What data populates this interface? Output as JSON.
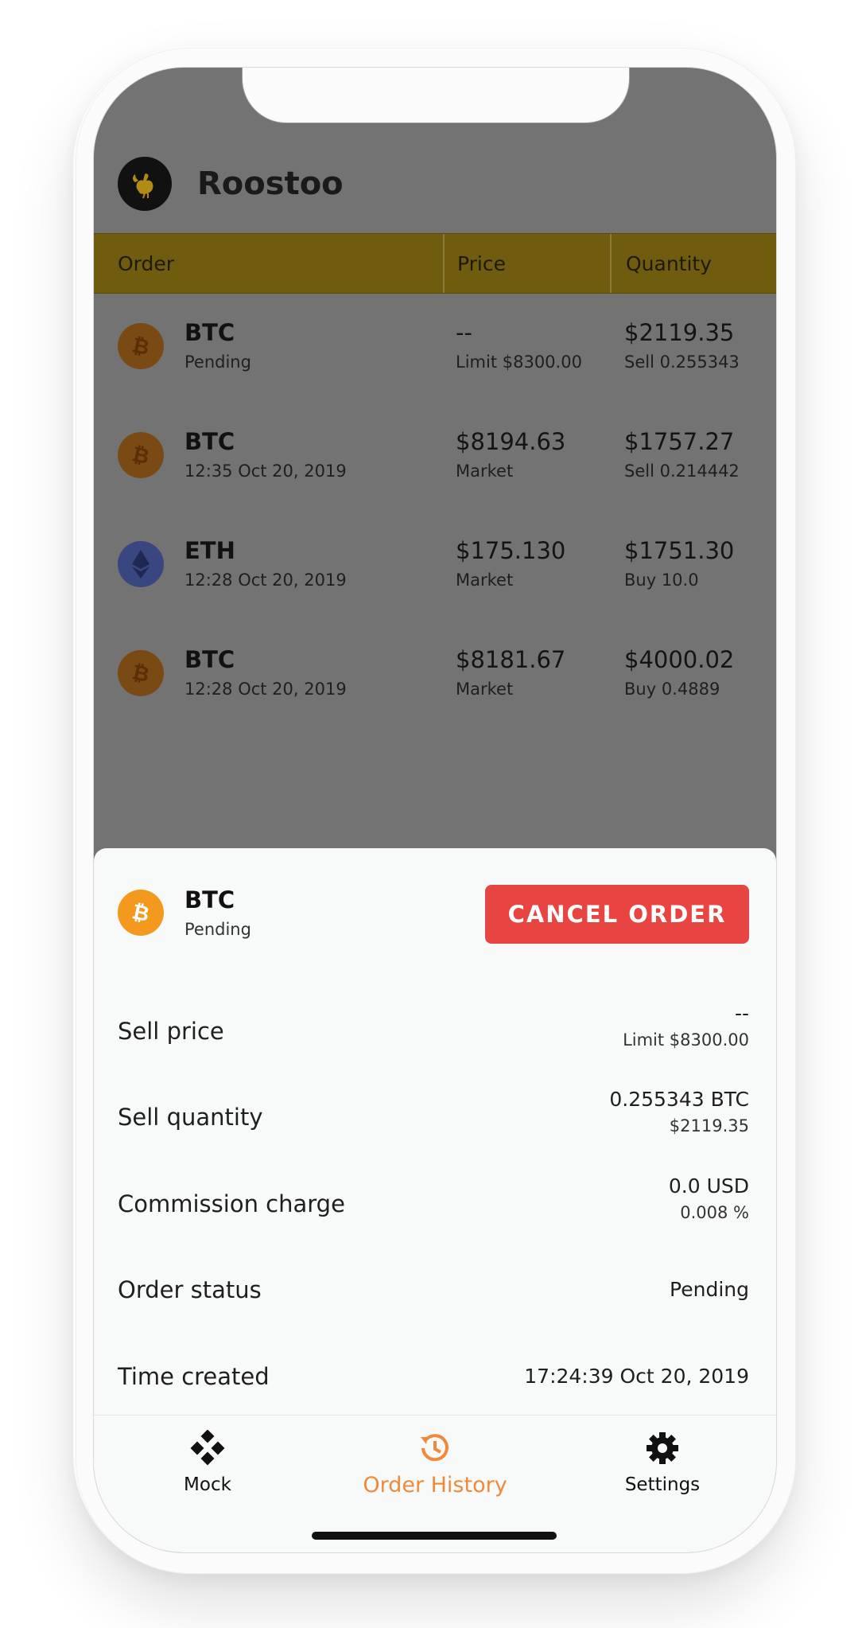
{
  "app": {
    "title": "Roostoo"
  },
  "table": {
    "headers": {
      "order": "Order",
      "price": "Price",
      "quantity": "Quantity"
    },
    "rows": [
      {
        "coin": "BTC",
        "sub": "Pending",
        "price": "--",
        "price_sub": "Limit $8300.00",
        "qty": "$2119.35",
        "qty_sub": "Sell 0.255343",
        "icon": "bitcoin-icon"
      },
      {
        "coin": "BTC",
        "sub": "12:35 Oct 20, 2019",
        "price": "$8194.63",
        "price_sub": "Market",
        "qty": "$1757.27",
        "qty_sub": "Sell 0.214442",
        "icon": "bitcoin-icon"
      },
      {
        "coin": "ETH",
        "sub": "12:28 Oct 20, 2019",
        "price": "$175.130",
        "price_sub": "Market",
        "qty": "$1751.30",
        "qty_sub": "Buy 10.0",
        "icon": "ethereum-icon"
      },
      {
        "coin": "BTC",
        "sub": "12:28 Oct 20, 2019",
        "price": "$8181.67",
        "price_sub": "Market",
        "qty": "$4000.02",
        "qty_sub": "Buy 0.4889",
        "icon": "bitcoin-icon"
      }
    ]
  },
  "sheet": {
    "coin": "BTC",
    "status": "Pending",
    "cancel_label": "CANCEL ORDER",
    "details": [
      {
        "label": "Sell price",
        "value": "--",
        "value_sub": "Limit $8300.00"
      },
      {
        "label": "Sell quantity",
        "value": "0.255343 BTC",
        "value_sub": "$2119.35"
      },
      {
        "label": "Commission charge",
        "value": "0.0 USD",
        "value_sub": "0.008 %"
      },
      {
        "label": "Order status",
        "value": "Pending",
        "value_sub": ""
      },
      {
        "label": "Time created",
        "value": "17:24:39 Oct 20, 2019",
        "value_sub": ""
      }
    ]
  },
  "tabs": [
    {
      "label": "Mock",
      "icon": "gamepad-icon",
      "active": false
    },
    {
      "label": "Order History",
      "icon": "history-icon",
      "active": true
    },
    {
      "label": "Settings",
      "icon": "gear-icon",
      "active": false
    }
  ],
  "colors": {
    "accent": "#f08a3a",
    "cancel": "#e84442",
    "header_bar": "#6f5c0f",
    "overlay": "#737373",
    "bitcoin": "#f39a1e",
    "ethereum": "#3a4680"
  }
}
